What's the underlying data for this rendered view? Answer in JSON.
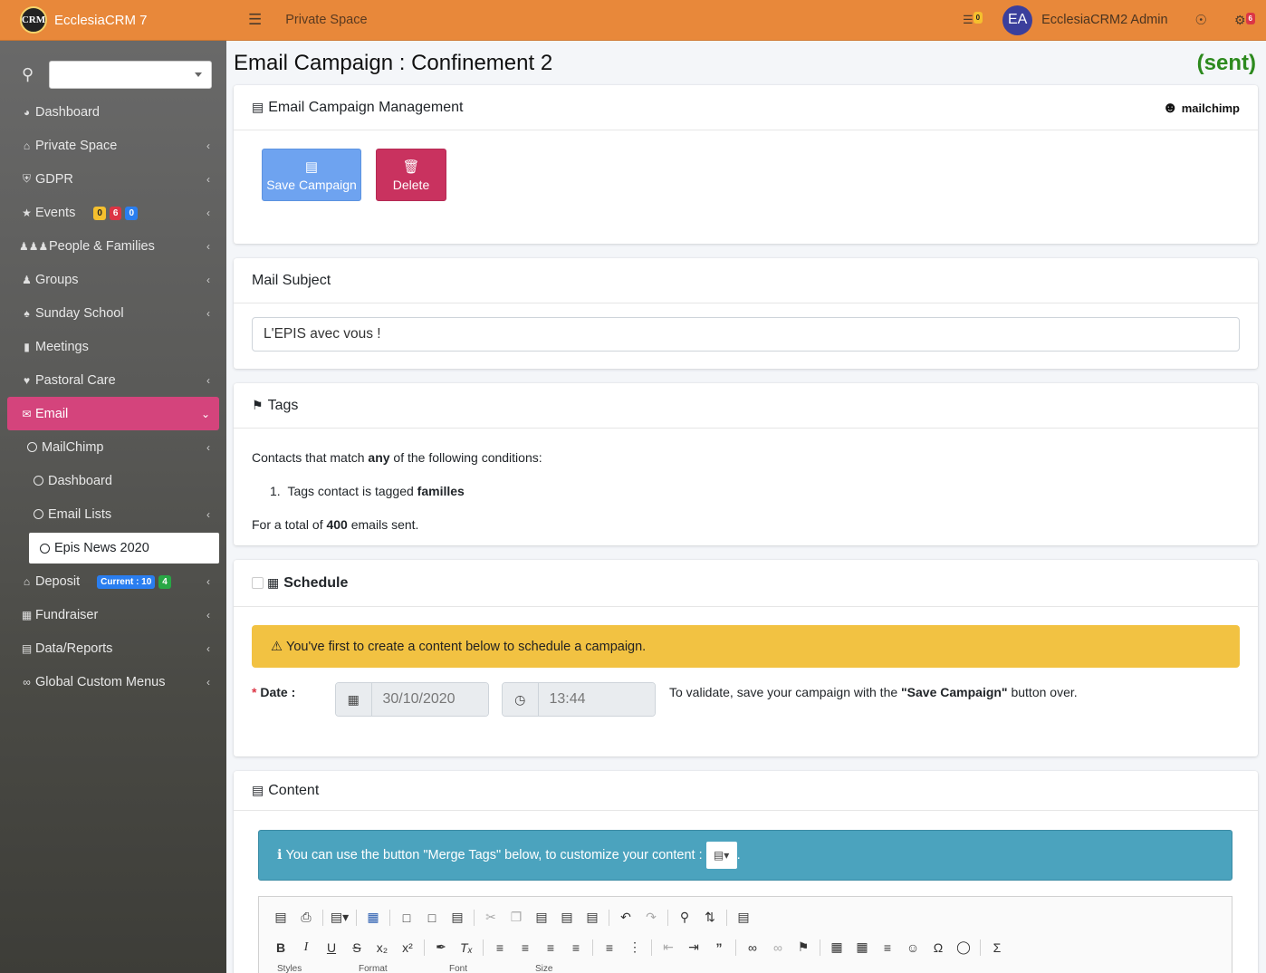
{
  "app": {
    "name": "EcclesiaCRM 7",
    "logo_text": "CRM"
  },
  "topbar": {
    "section": "Private Space",
    "cart_count": "0",
    "user_initials": "EA",
    "user_name": "EcclesiaCRM2 Admin",
    "notif_count": "6"
  },
  "sidebar": {
    "items": [
      {
        "label": "Dashboard",
        "icon": "dashboard-icon"
      },
      {
        "label": "Private Space",
        "icon": "home-icon"
      },
      {
        "label": "GDPR",
        "icon": "shield-icon"
      },
      {
        "label": "Events",
        "icon": "ticket-icon",
        "badges": [
          "0",
          "6",
          "0"
        ]
      },
      {
        "label": "People & Families",
        "icon": "people-icon"
      },
      {
        "label": "Groups",
        "icon": "users-icon"
      },
      {
        "label": "Sunday School",
        "icon": "child-icon"
      },
      {
        "label": "Meetings",
        "icon": "video-icon"
      },
      {
        "label": "Pastoral Care",
        "icon": "heartbeat-icon"
      },
      {
        "label": "Email",
        "icon": "envelope-icon"
      },
      {
        "label": "MailChimp"
      },
      {
        "label": "Dashboard"
      },
      {
        "label": "Email Lists"
      },
      {
        "label": "Epis News 2020"
      },
      {
        "label": "Deposit",
        "icon": "bank-icon",
        "badges": [
          "Current : 10",
          "4"
        ]
      },
      {
        "label": "Fundraiser",
        "icon": "money-icon"
      },
      {
        "label": "Data/Reports",
        "icon": "file-pdf-icon"
      },
      {
        "label": "Global Custom Menus",
        "icon": "link-icon"
      }
    ]
  },
  "page": {
    "title": "Email Campaign : Confinement 2",
    "status": "(sent)"
  },
  "management": {
    "title": "Email Campaign Management",
    "brand": "mailchimp",
    "save_label": "Save Campaign",
    "delete_label": "Delete"
  },
  "subject": {
    "title": "Mail Subject",
    "value": "L'EPIS avec vous !"
  },
  "tags": {
    "title": "Tags",
    "intro_pre": "Contacts that match ",
    "intro_bold": "any",
    "intro_post": " of the following conditions:",
    "condition_num": "1.",
    "condition_pre": "Tags contact is tagged ",
    "condition_bold": "familles",
    "total_pre": "For a total of ",
    "total_bold": "400",
    "total_post": " emails sent."
  },
  "schedule": {
    "title": "Schedule",
    "warning": "You've first to create a content below to schedule a campaign.",
    "date_label": "Date :",
    "date_value": "30/10/2020",
    "time_value": "13:44",
    "hint_pre": "To validate, save your campaign with the ",
    "hint_bold": "\"Save Campaign\"",
    "hint_post": " button over."
  },
  "content": {
    "title": "Content",
    "info": "You can use the button \"Merge Tags\" below, to customize your content :",
    "toolbar_labels": [
      "Styles",
      "Format",
      "Font",
      "Size"
    ]
  },
  "colors": {
    "orange": "#e8883a",
    "pink": "#d4447c",
    "blue_btn": "#6ea3f0",
    "red_btn": "#c9325f",
    "green_sent": "#2d8a1e",
    "warn": "#f2c242",
    "info": "#4ba3be"
  }
}
